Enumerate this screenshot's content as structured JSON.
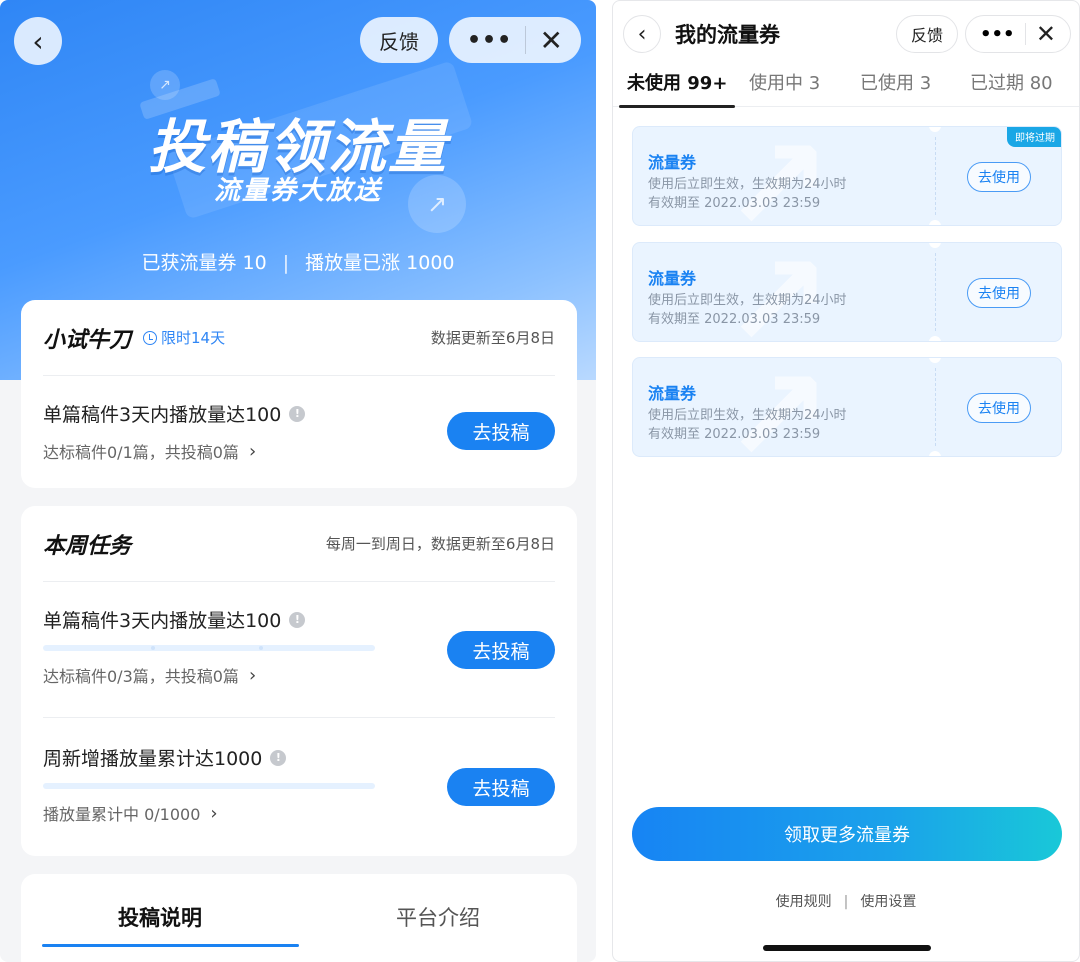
{
  "left": {
    "nav": {
      "feedback": "反馈",
      "more": "•••",
      "close": "✕",
      "back": "‹"
    },
    "hero": {
      "title": "投稿领流量",
      "subtitle": "流量券大放送",
      "stat_coupons": "已获流量券 10",
      "stat_divider": "|",
      "stat_plays": "播放量已涨 1000"
    },
    "card1": {
      "title": "小试牛刀",
      "limit": "限时14天",
      "update": "数据更新至6月8日",
      "task": {
        "title": "单篇稿件3天内播放量达100",
        "sub": "达标稿件0/1篇，共投稿0篇",
        "button": "去投稿"
      }
    },
    "card2": {
      "title": "本周任务",
      "update": "每周一到周日，数据更新至6月8日",
      "tasks": [
        {
          "title": "单篇稿件3天内播放量达100",
          "sub": "达标稿件0/3篇，共投稿0篇",
          "button": "去投稿",
          "progress": 0
        },
        {
          "title": "周新增播放量累计达1000",
          "sub": "播放量累计中 0/1000",
          "button": "去投稿",
          "progress": 0
        }
      ]
    },
    "bottom_tabs": [
      {
        "label": "投稿说明",
        "active": true
      },
      {
        "label": "平台介绍",
        "active": false
      }
    ]
  },
  "right": {
    "nav": {
      "back": "‹",
      "title": "我的流量券",
      "feedback": "反馈",
      "more": "•••",
      "close": "✕"
    },
    "tabs": [
      {
        "label": "未使用 99+",
        "active": true
      },
      {
        "label": "使用中 3",
        "active": false
      },
      {
        "label": "已使用 3",
        "active": false
      },
      {
        "label": "已过期 80",
        "active": false
      }
    ],
    "coupons": [
      {
        "name": "流量券",
        "rule": "使用后立即生效，生效期为24小时",
        "expiry": "有效期至 2022.03.03 23:59",
        "button": "去使用",
        "badge": "即将过期"
      },
      {
        "name": "流量券",
        "rule": "使用后立即生效，生效期为24小时",
        "expiry": "有效期至 2022.03.03 23:59",
        "button": "去使用",
        "badge": ""
      },
      {
        "name": "流量券",
        "rule": "使用后立即生效，生效期为24小时",
        "expiry": "有效期至 2022.03.03 23:59",
        "button": "去使用",
        "badge": ""
      }
    ],
    "cta": "领取更多流量券",
    "links": {
      "rules": "使用规则",
      "divider": "|",
      "settings": "使用设置"
    }
  },
  "colors": {
    "brand_blue": "#1a82f2",
    "hero_start": "#2f86f5",
    "cta_end": "#19c8d8",
    "badge": "#1aa7e6"
  }
}
